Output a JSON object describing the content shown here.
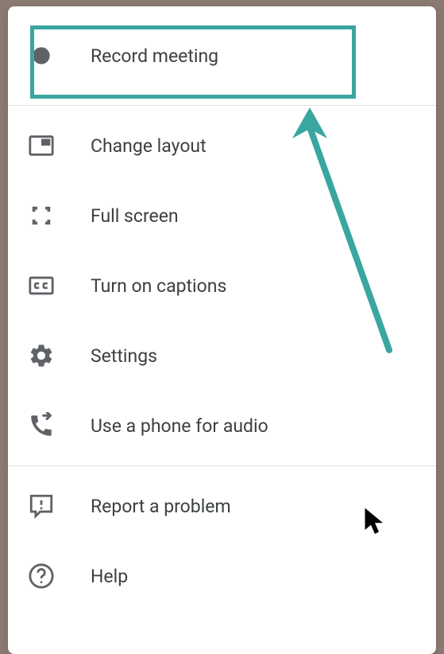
{
  "menu": {
    "record": {
      "label": "Record meeting"
    },
    "layout": {
      "label": "Change layout"
    },
    "fullscreen": {
      "label": "Full screen"
    },
    "captions": {
      "label": "Turn on captions"
    },
    "settings": {
      "label": "Settings"
    },
    "phone": {
      "label": "Use a phone for audio"
    },
    "report": {
      "label": "Report a problem"
    },
    "help": {
      "label": "Help"
    }
  },
  "annotation": {
    "highlight_color": "#3aa6a0"
  }
}
